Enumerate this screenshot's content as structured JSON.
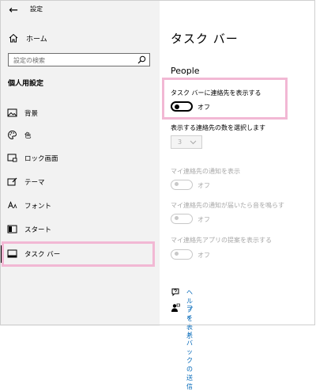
{
  "window": {
    "title": "設定",
    "back_glyph": "←"
  },
  "sidebar": {
    "home_label": "ホーム",
    "search_placeholder": "設定の検索",
    "section_title": "個人用設定",
    "items": [
      {
        "label": "背景",
        "icon": "image-icon"
      },
      {
        "label": "色",
        "icon": "palette-icon"
      },
      {
        "label": "ロック画面",
        "icon": "lock-screen-icon"
      },
      {
        "label": "テーマ",
        "icon": "theme-icon"
      },
      {
        "label": "フォント",
        "icon": "font-icon"
      },
      {
        "label": "スタート",
        "icon": "start-icon"
      },
      {
        "label": "タスク バー",
        "icon": "taskbar-icon",
        "active": true
      }
    ]
  },
  "main": {
    "title": "タスク バー",
    "section": "People",
    "settings": [
      {
        "label": "タスク バーに連絡先を表示する",
        "state": "オフ",
        "enabled": true
      },
      {
        "label": "表示する連絡先の数を選択します",
        "type": "dropdown",
        "value": "3",
        "enabled": false
      },
      {
        "label": "マイ連絡先の通知を表示",
        "state": "オフ",
        "enabled": false
      },
      {
        "label": "マイ連絡先の通知が届いたら音を鳴らす",
        "state": "オフ",
        "enabled": false
      },
      {
        "label": "マイ連絡先アプリの提案を表示する",
        "state": "オフ",
        "enabled": false
      }
    ],
    "links": [
      {
        "label": "ヘルプを表示",
        "icon": "help-chat-icon"
      },
      {
        "label": "フィードバックの送信",
        "icon": "feedback-icon"
      }
    ]
  }
}
